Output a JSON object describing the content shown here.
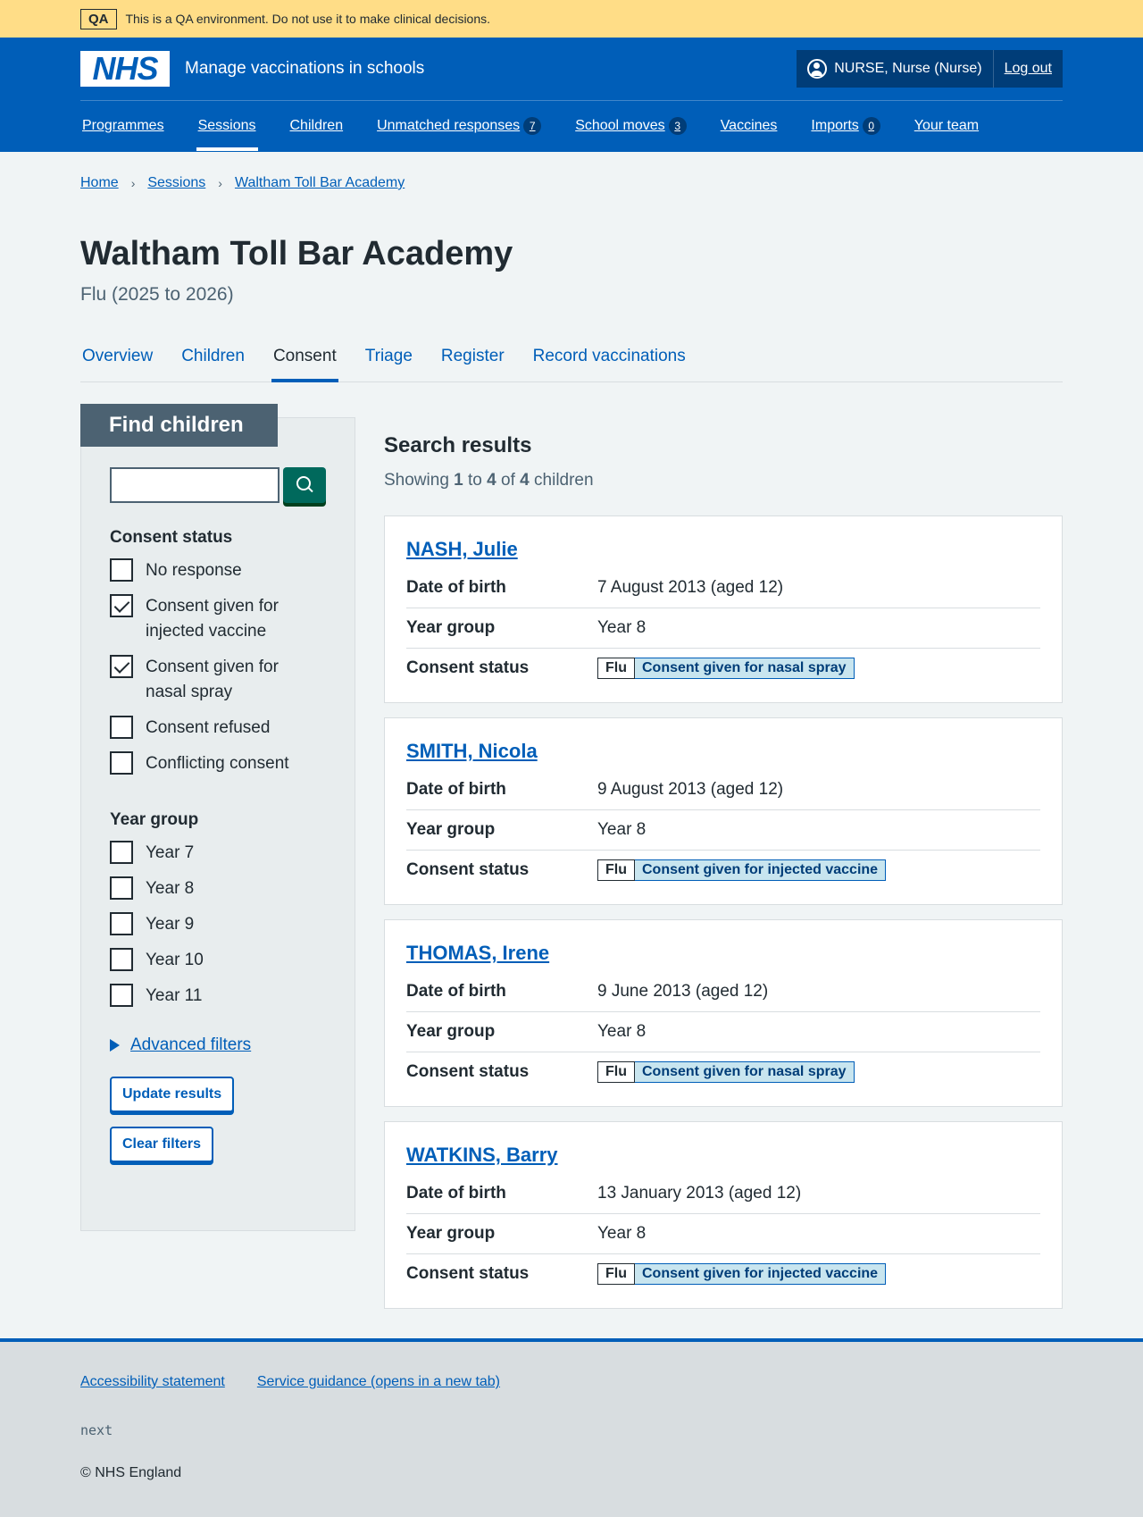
{
  "qa_banner": {
    "tag": "QA",
    "text": "This is a QA environment. Do not use it to make clinical decisions."
  },
  "header": {
    "logo": "NHS",
    "service_name": "Manage vaccinations in schools",
    "user": "NURSE, Nurse (Nurse)",
    "logout": "Log out"
  },
  "nav": [
    {
      "label": "Programmes",
      "badge": ""
    },
    {
      "label": "Sessions",
      "badge": "",
      "active": true
    },
    {
      "label": "Children",
      "badge": ""
    },
    {
      "label": "Unmatched responses",
      "badge": "7"
    },
    {
      "label": "School moves",
      "badge": "3"
    },
    {
      "label": "Vaccines",
      "badge": ""
    },
    {
      "label": "Imports",
      "badge": "0"
    },
    {
      "label": "Your team",
      "badge": ""
    }
  ],
  "breadcrumb": [
    "Home",
    "Sessions",
    "Waltham Toll Bar Academy"
  ],
  "page": {
    "title": "Waltham Toll Bar Academy",
    "caption": "Flu (2025 to 2026)"
  },
  "tabs": [
    "Overview",
    "Children",
    "Consent",
    "Triage",
    "Register",
    "Record vaccinations"
  ],
  "filters": {
    "heading": "Find children",
    "search_value": "",
    "consent_title": "Consent status",
    "consent_options": [
      {
        "label": "No response",
        "checked": false
      },
      {
        "label": "Consent given for injected vaccine",
        "checked": true
      },
      {
        "label": "Consent given for nasal spray",
        "checked": true
      },
      {
        "label": "Consent refused",
        "checked": false
      },
      {
        "label": "Conflicting consent",
        "checked": false
      }
    ],
    "year_title": "Year group",
    "year_options": [
      {
        "label": "Year 7",
        "checked": false
      },
      {
        "label": "Year 8",
        "checked": false
      },
      {
        "label": "Year 9",
        "checked": false
      },
      {
        "label": "Year 10",
        "checked": false
      },
      {
        "label": "Year 11",
        "checked": false
      }
    ],
    "advanced": "Advanced filters",
    "update_button": "Update results",
    "clear_button": "Clear filters"
  },
  "results": {
    "title": "Search results",
    "showing_prefix": "Showing",
    "from": "1",
    "to_word": "to",
    "to": "4",
    "of_word": "of",
    "total": "4",
    "suffix": "children",
    "row_labels": {
      "dob": "Date of birth",
      "year": "Year group",
      "consent": "Consent status"
    },
    "children": [
      {
        "name": "NASH, Julie",
        "dob": "7 August 2013 (aged 12)",
        "year": "Year 8",
        "programme": "Flu",
        "status": "Consent given for nasal spray"
      },
      {
        "name": "SMITH, Nicola",
        "dob": "9 August 2013 (aged 12)",
        "year": "Year 8",
        "programme": "Flu",
        "status": "Consent given for injected vaccine"
      },
      {
        "name": "THOMAS, Irene",
        "dob": "9 June 2013 (aged 12)",
        "year": "Year 8",
        "programme": "Flu",
        "status": "Consent given for nasal spray"
      },
      {
        "name": "WATKINS, Barry",
        "dob": "13 January 2013 (aged 12)",
        "year": "Year 8",
        "programme": "Flu",
        "status": "Consent given for injected vaccine"
      }
    ]
  },
  "footer": {
    "links": [
      "Accessibility statement",
      "Service guidance (opens in a new tab)"
    ],
    "version": "next",
    "copyright": "© NHS England"
  }
}
